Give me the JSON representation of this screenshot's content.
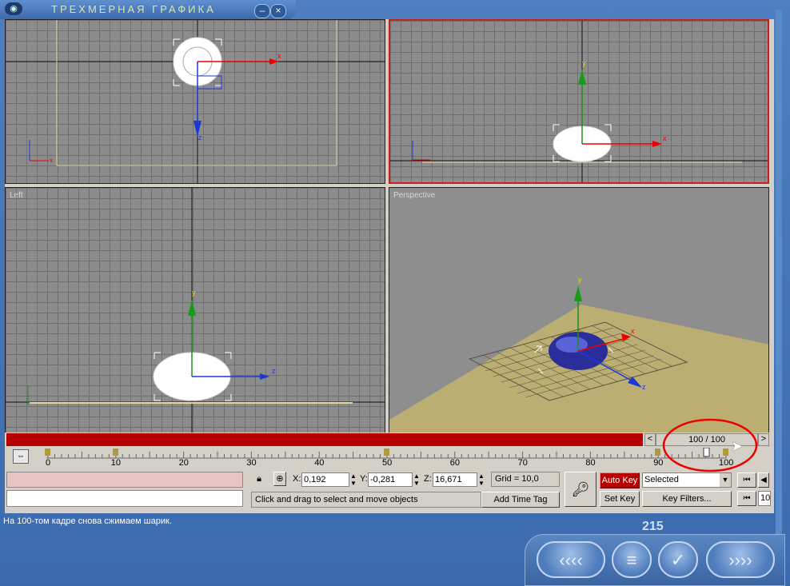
{
  "window": {
    "title": "ТРЕХМЕРНАЯ ГРАФИКА",
    "minimize": "–",
    "close": "×",
    "icon": "app-eye-icon"
  },
  "viewports": {
    "top_label": "",
    "front_label": "",
    "left_label": "Left",
    "persp_label": "Perspective"
  },
  "timeline": {
    "frame_display": "100 / 100",
    "prev_arrow": "<",
    "next_arrow": ">",
    "ticks": [
      "0",
      "10",
      "20",
      "30",
      "40",
      "50",
      "60",
      "70",
      "80",
      "90",
      "100"
    ]
  },
  "controls": {
    "x_label": "X:",
    "x_value": "0,192",
    "y_label": "Y:",
    "y_value": "-0,281",
    "z_label": "Z:",
    "z_value": "16,671",
    "grid": "Grid = 10,0",
    "prompt": "Click and drag to select and move objects",
    "add_time_tag": "Add Time Tag",
    "auto_key": "Auto Key",
    "set_key": "Set Key",
    "selected": "Selected",
    "key_filters": "Key Filters...",
    "frame_field": "10"
  },
  "footer": {
    "message": "На 100-том кадре снова сжимаем шарик.",
    "page": "215"
  },
  "nav": {
    "back": "‹‹‹‹",
    "contents": "≡",
    "check": "✓",
    "forward": "››››"
  },
  "colors": {
    "accent_red": "#b70000",
    "frame_blue": "#3a68a8"
  }
}
